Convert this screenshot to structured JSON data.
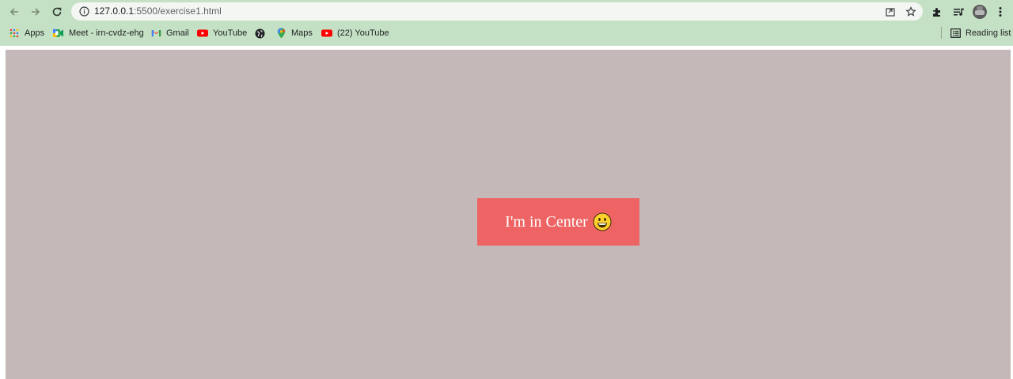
{
  "browser": {
    "url_host": "127.0.0.1",
    "url_path": ":5500/exercise1.html",
    "bookmarks": [
      {
        "label": "Apps",
        "icon": "apps-grid-icon"
      },
      {
        "label": "Meet - irn-cvdz-ehg",
        "icon": "google-meet-icon"
      },
      {
        "label": "Gmail",
        "icon": "gmail-icon"
      },
      {
        "label": "YouTube",
        "icon": "youtube-icon"
      },
      {
        "label": "",
        "icon": "globe-icon"
      },
      {
        "label": "Maps",
        "icon": "google-maps-icon"
      },
      {
        "label": "(22) YouTube",
        "icon": "youtube-icon"
      }
    ],
    "reading_list": "Reading list",
    "colors": {
      "chrome": "#c5e1c5",
      "omnibox": "#f3f6f3"
    }
  },
  "page": {
    "background": "#c4b8b8",
    "box": {
      "text": "I'm in Center",
      "emoji": "smiling-face-icon",
      "background": "#ee6363",
      "text_color": "#ffffff"
    }
  }
}
